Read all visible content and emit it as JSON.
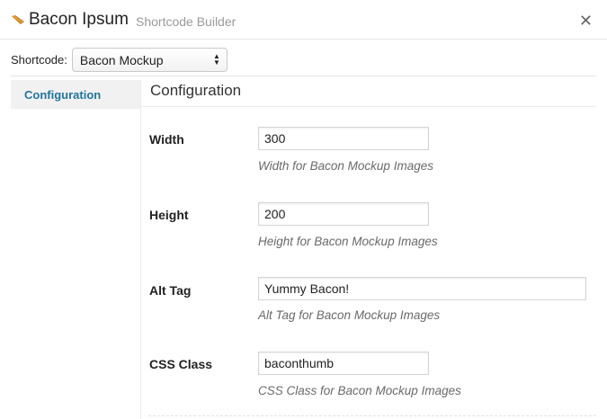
{
  "header": {
    "title": "Bacon Ipsum",
    "subtitle": "Shortcode Builder",
    "close_symbol": "✕",
    "logo_icon": "bacon-strip-icon",
    "logo_color": "#c8801a"
  },
  "shortcode": {
    "label": "Shortcode:",
    "selected": "Bacon Mockup"
  },
  "sidebar": {
    "items": [
      {
        "label": "Configuration",
        "active": true
      }
    ],
    "active_color": "#21759b"
  },
  "main": {
    "title": "Configuration",
    "fields": [
      {
        "label": "Width",
        "value": "300",
        "description": "Width for Bacon Mockup Images"
      },
      {
        "label": "Height",
        "value": "200",
        "description": "Height for Bacon Mockup Images"
      },
      {
        "label": "Alt Tag",
        "value": "Yummy Bacon!",
        "description": "Alt Tag for Bacon Mockup Images"
      },
      {
        "label": "CSS Class",
        "value": "baconthumb",
        "description": "CSS Class for Bacon Mockup Images"
      }
    ]
  }
}
